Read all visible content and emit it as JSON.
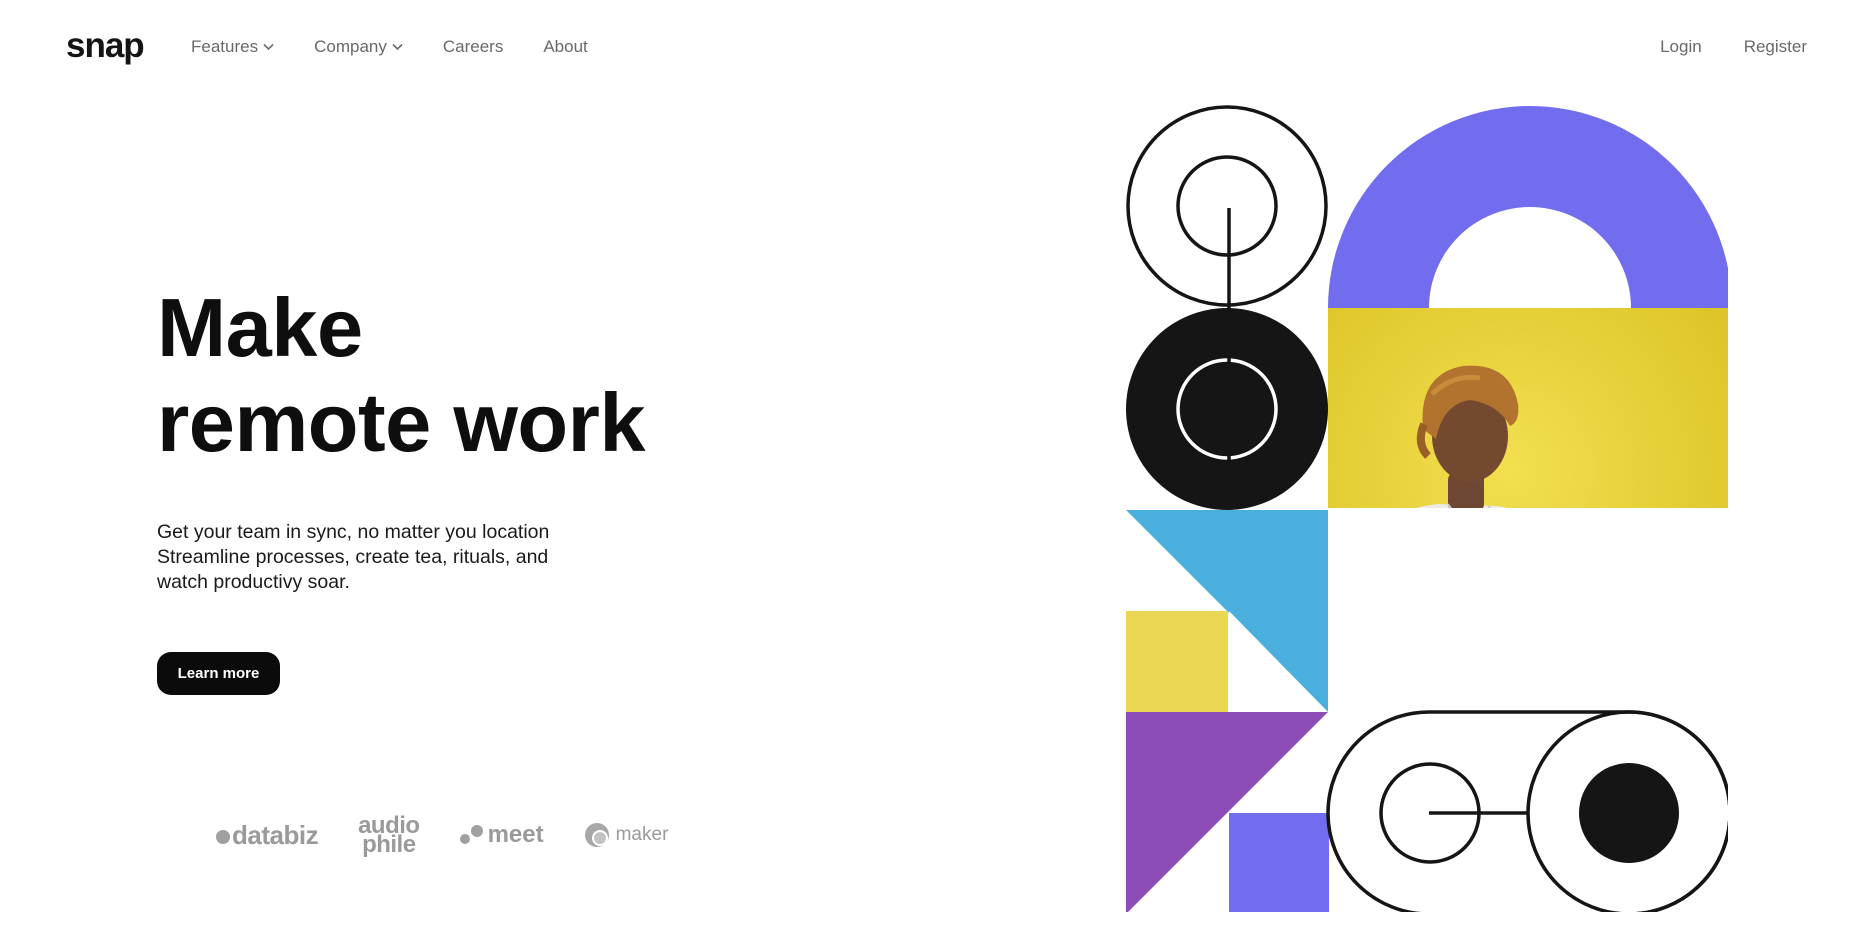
{
  "brand": {
    "logo": "snap"
  },
  "nav": {
    "items": [
      {
        "label": "Features",
        "has_dropdown": true
      },
      {
        "label": "Company",
        "has_dropdown": true
      },
      {
        "label": "Careers",
        "has_dropdown": false
      },
      {
        "label": "About",
        "has_dropdown": false
      }
    ],
    "auth": {
      "login": "Login",
      "register": "Register"
    }
  },
  "hero": {
    "title_lines": [
      "Make",
      "remote work"
    ],
    "description_lines": [
      "Get your team in sync, no matter you location",
      "Streamline processes, create tea, rituals, and",
      "watch productivy soar."
    ],
    "cta_label": "Learn more"
  },
  "clients": {
    "databiz": "databiz",
    "audiophile_top": "audio",
    "audiophile_bottom": "phile",
    "meet": "meet",
    "maker": "maker"
  },
  "colors": {
    "text": "#141414",
    "nav_text": "#696969",
    "black": "#151515",
    "indigo": "#726dee",
    "sky": "#4aafdc",
    "yellow": "#ead652",
    "purple": "#8d4cb8",
    "photo_bg": "#e6cd30",
    "logo_grey": "#9a9a9a"
  },
  "icons": [
    "chevron-down-icon",
    "databiz-logo-icon",
    "meet-logo-icon",
    "maker-logo-icon"
  ]
}
